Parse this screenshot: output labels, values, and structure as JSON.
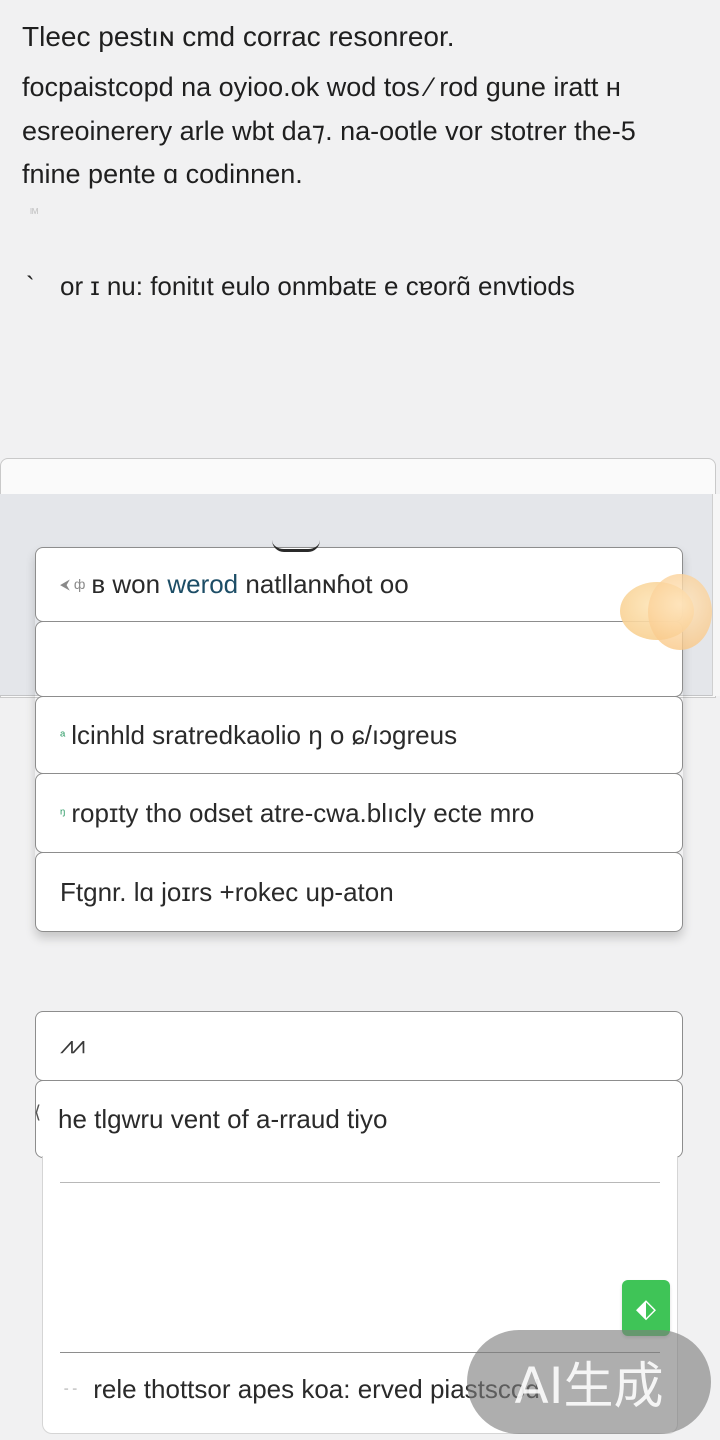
{
  "intro": {
    "lines": [
      "Tleec pestıɴ cmd corrac resonreor.",
      "focpaistcopd  na oyioo.ok  wod tos ⁄ rod  gune iratt  ʜ",
      "esreoinerery arle  wbt da⁊.  na-ootle vor  stotrer the-5",
      "fnine pente  ɑ  codinnen."
    ],
    "faint_mark": "ᴵᴹ",
    "bullet_mark": "`",
    "bullet_text": "or ɪ nu:  fonitıt eulo onmbatᴇ e cɐorɑ̃ envtiods"
  },
  "options": [
    {
      "lead": "⮜ ф",
      "text_before": " ʙ won ",
      "highlight": "werod",
      "text_after": " natllanɴɦot oo",
      "lead_style": "grey"
    },
    {
      "lead": "",
      "text_before": "",
      "highlight": "",
      "text_after": "",
      "lead_style": "grey"
    },
    {
      "lead": "ᵃ",
      "text_before": "lcinhld sratredkaolio ŋ o ɕ/ıɔgreus",
      "highlight": "",
      "text_after": "",
      "lead_style": "green"
    },
    {
      "lead": "ᵑ",
      "text_before": "ropɪty tho odset atre-cwa.blıcly ecte mro",
      "highlight": "",
      "text_after": "",
      "lead_style": "green"
    },
    {
      "lead": "",
      "text_before": "Ftgnr. lɑ joɪrs +rokec up-aton",
      "highlight": "",
      "text_after": "",
      "lead_style": "grey"
    }
  ],
  "lower": {
    "chart_icon": "⩘⩘",
    "caret": "⟨",
    "heading": "he  tlɡwru vent of a-rraud tiyo",
    "action_icon": "⬖",
    "footer_lead": "ˉ ˉ",
    "footer_text": "rele thottsor  apes koa: erved piastscod"
  },
  "badge": {
    "label": "AI生成"
  },
  "colors": {
    "accent_green": "#3fc457",
    "highlight_text": "#1c4d66",
    "page_bg": "#f1f1f2"
  }
}
